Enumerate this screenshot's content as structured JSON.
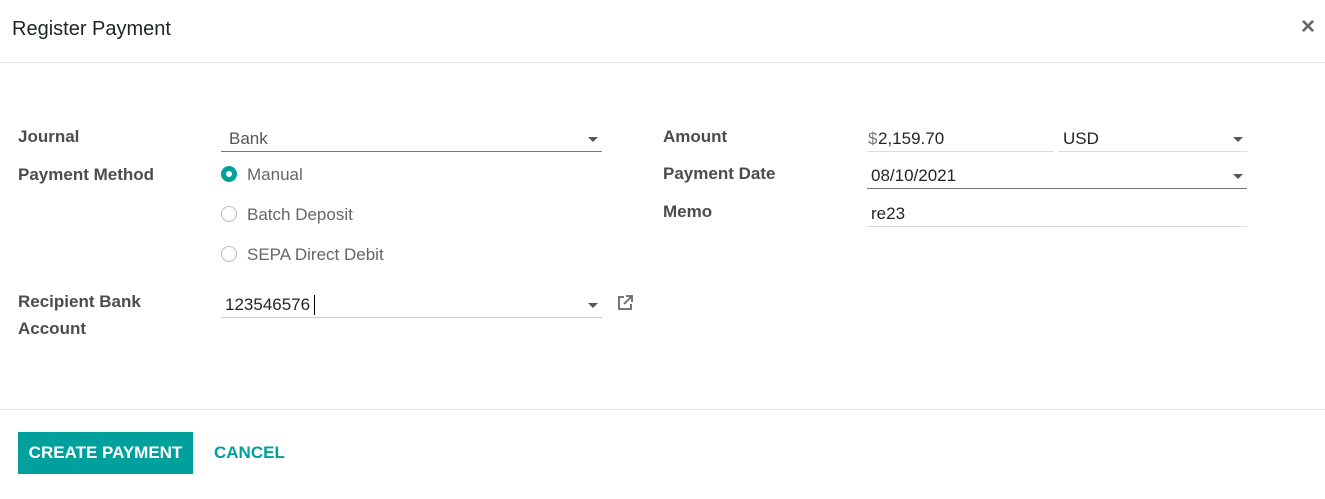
{
  "dialog": {
    "title": "Register Payment",
    "close_glyph": "×"
  },
  "form": {
    "journal": {
      "label": "Journal",
      "value": "Bank"
    },
    "payment_method": {
      "label": "Payment Method",
      "options": [
        {
          "label": "Manual",
          "selected": true
        },
        {
          "label": "Batch Deposit",
          "selected": false
        },
        {
          "label": "SEPA Direct Debit",
          "selected": false
        }
      ]
    },
    "recipient_bank": {
      "label_line1": "Recipient Bank",
      "label_line2": "Account",
      "value": "123546576"
    },
    "amount": {
      "label": "Amount",
      "currency_symbol": "$",
      "value": "2,159.70",
      "currency": "USD"
    },
    "payment_date": {
      "label": "Payment Date",
      "value": "08/10/2021"
    },
    "memo": {
      "label": "Memo",
      "value": "re23"
    }
  },
  "footer": {
    "create_label": "CREATE PAYMENT",
    "cancel_label": "CANCEL"
  },
  "colors": {
    "accent": "#00a09d"
  },
  "icons": {
    "close": "close-icon",
    "dropdown": "chevron-down-icon",
    "external_link": "external-link-icon"
  }
}
